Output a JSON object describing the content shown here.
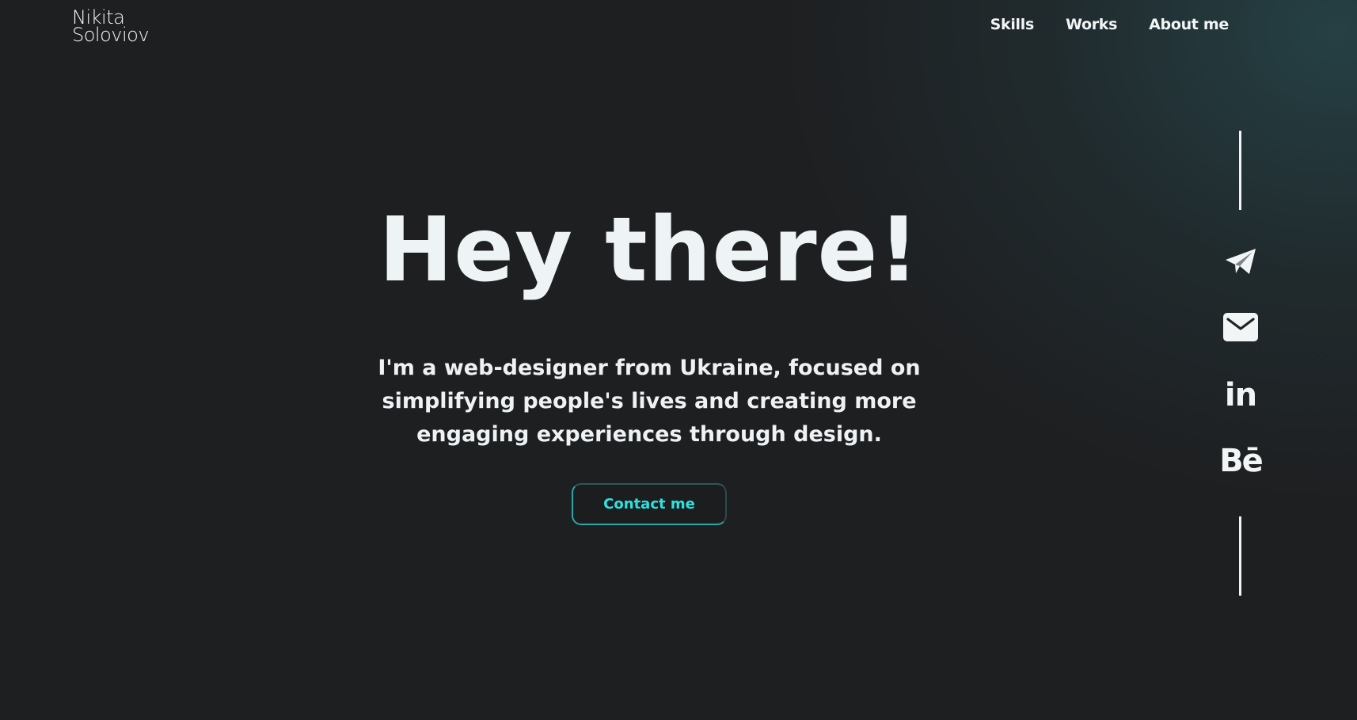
{
  "header": {
    "logo_line1": "Nikita",
    "logo_line2": "Soloviov",
    "nav": [
      {
        "label": "Skills"
      },
      {
        "label": "Works"
      },
      {
        "label": "About me"
      }
    ]
  },
  "hero": {
    "title": "Hey there!",
    "text": "I'm a web-designer from Ukraine, focused on simplifying people's lives and creating more engaging experiences through design.",
    "cta_label": "Contact me"
  },
  "social": {
    "icons": [
      "telegram-icon",
      "mail-icon",
      "linkedin-icon",
      "behance-icon"
    ],
    "linkedin_glyph": "in",
    "behance_glyph": "Bē"
  },
  "colors": {
    "background": "#1e1f21",
    "accent": "#2de3e0",
    "text": "#eef3f5"
  }
}
